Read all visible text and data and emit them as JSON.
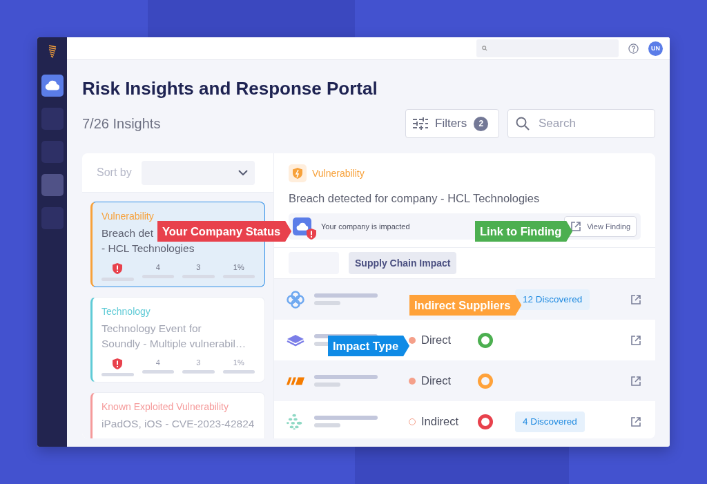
{
  "sidebar": {
    "items": [
      {
        "selected": true,
        "highlighted": false
      },
      {
        "selected": false,
        "highlighted": false
      },
      {
        "selected": false,
        "highlighted": false
      },
      {
        "selected": false,
        "highlighted": true
      },
      {
        "selected": false,
        "highlighted": false
      }
    ]
  },
  "topbar": {
    "avatar": "UN"
  },
  "page_title": "Risk Insights and Response Portal",
  "insight_count": "7/26 Insights",
  "filters": {
    "label": "Filters",
    "count": "2"
  },
  "search": {
    "placeholder": "Search"
  },
  "sort": {
    "label": "Sort by"
  },
  "insights": [
    {
      "category": "Vulnerability",
      "color": "#f7a13a",
      "title_lines": [
        "Breach det",
        "- HCL Technologies"
      ],
      "selected": true,
      "stats": [
        "4",
        "3",
        "1%"
      ]
    },
    {
      "category": "Technology",
      "color": "#5fcbd6",
      "title_lines": [
        "Technology Event for",
        "Soundly - Multiple vulnerabil…"
      ],
      "selected": false,
      "stats": [
        "4",
        "3",
        "1%"
      ]
    },
    {
      "category": "Known Exploited Vulnerability",
      "color": "#f59a9a",
      "title_lines": [
        "iPadOS, iOS - CVE-2023-42824"
      ],
      "selected": false
    }
  ],
  "detail": {
    "category": "Vulnerability",
    "title": "Breach detected for company - HCL Technologies",
    "status": "Your company is impacted",
    "impacted": true,
    "action": "View Finding"
  },
  "tabs": [
    {
      "kind": "blank",
      "selected": false
    },
    {
      "kind": "text",
      "label": "Supply Chain Impact",
      "selected": true
    }
  ],
  "suppliers": [
    {
      "kind": "rings",
      "discovered": "12 Discovered"
    },
    {
      "kind": "stack",
      "impact": "Direct",
      "dot_filled": true,
      "color": "#4caf50"
    },
    {
      "kind": "stripes",
      "impact": "Direct",
      "dot_filled": true,
      "color": "#ffa23a"
    },
    {
      "kind": "dots",
      "impact": "Indirect",
      "dot_filled": false,
      "color": "#e8414c",
      "discovered": "4 Discovered"
    }
  ],
  "callouts": [
    {
      "label": "Your Company Status",
      "color": "#e8414c"
    },
    {
      "label": "Link to Finding",
      "color": "#4caf50"
    },
    {
      "label": "Indirect Suppliers",
      "color": "#ffa23a"
    },
    {
      "label": "Impact Type",
      "color": "#0f8be6"
    }
  ]
}
